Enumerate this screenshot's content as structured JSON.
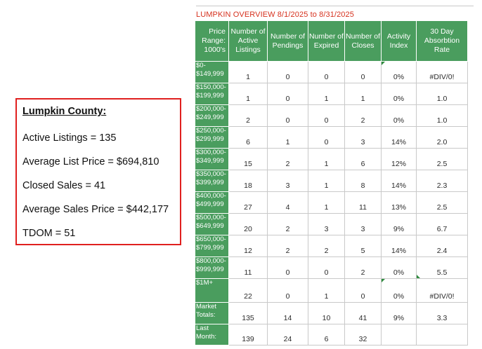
{
  "summary": {
    "title": "Lumpkin County:",
    "lines": [
      "Active Listings = 135",
      "Average List Price = $694,810",
      "Closed Sales = 41",
      "Average Sales Price = $442,177",
      "TDOM = 51"
    ]
  },
  "sheet": {
    "title": "LUMPKIN OVERVIEW 8/1/2025 to 8/31/2025",
    "headers": [
      "Price Range: 1000's",
      "Number of Active Listings",
      "Number of Pendings",
      "Number of Expired",
      "Number of Closes",
      "Activity Index",
      "30 Day Absorbtion Rate"
    ],
    "rows": [
      [
        "$0-\n$149,999",
        "1",
        "0",
        "0",
        "0",
        "0%",
        "#DIV/0!"
      ],
      [
        "$150,000-\n$199,999",
        "1",
        "0",
        "1",
        "1",
        "0%",
        "1.0"
      ],
      [
        "$200,000-\n$249,999",
        "2",
        "0",
        "0",
        "2",
        "0%",
        "1.0"
      ],
      [
        "$250,000-\n$299,999",
        "6",
        "1",
        "0",
        "3",
        "14%",
        "2.0"
      ],
      [
        "$300,000-\n$349,999",
        "15",
        "2",
        "1",
        "6",
        "12%",
        "2.5"
      ],
      [
        "$350,000-\n$399,999",
        "18",
        "3",
        "1",
        "8",
        "14%",
        "2.3"
      ],
      [
        "$400,000-\n$499,999",
        "27",
        "4",
        "1",
        "11",
        "13%",
        "2.5"
      ],
      [
        "$500,000-\n$649,999",
        "20",
        "2",
        "3",
        "3",
        "9%",
        "6.7"
      ],
      [
        "$650,000-\n$799,999",
        "12",
        "2",
        "2",
        "5",
        "14%",
        "2.4"
      ],
      [
        "$800,000-\n$999,999",
        "11",
        "0",
        "0",
        "2",
        "0%",
        "5.5"
      ],
      [
        "$1M+",
        "22",
        "0",
        "1",
        "0",
        "0%",
        "#DIV/0!"
      ],
      [
        "Market\nTotals:",
        "135",
        "14",
        "10",
        "41",
        "9%",
        "3.3"
      ],
      [
        "Last\nMonth:",
        "139",
        "24",
        "6",
        "32",
        "",
        ""
      ]
    ]
  }
}
